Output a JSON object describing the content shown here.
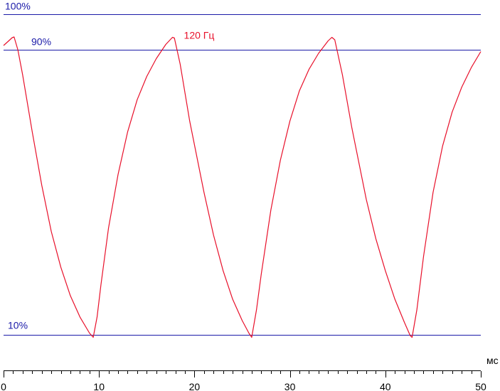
{
  "chart_data": {
    "type": "line",
    "x_unit": "мс",
    "xlim": [
      0,
      50
    ],
    "ylim": [
      0,
      110
    ],
    "x_ticks": [
      0,
      10,
      20,
      30,
      40,
      50
    ],
    "x_minor_step": 1,
    "reference_lines": [
      {
        "y": 100,
        "label": "100%"
      },
      {
        "y": 90,
        "label": "90%"
      },
      {
        "y": 10,
        "label": "10%"
      }
    ],
    "series": [
      {
        "name": "120 Гц",
        "color": "#e8102a",
        "points": [
          [
            0.0,
            91.2
          ],
          [
            0.5,
            92.4
          ],
          [
            0.9,
            93.4
          ],
          [
            1.1,
            93.6
          ],
          [
            1.5,
            90.0
          ],
          [
            2.0,
            83.0
          ],
          [
            3.0,
            67.0
          ],
          [
            4.0,
            52.0
          ],
          [
            5.0,
            39.0
          ],
          [
            6.0,
            29.0
          ],
          [
            7.0,
            21.0
          ],
          [
            8.0,
            15.0
          ],
          [
            9.0,
            10.5
          ],
          [
            9.4,
            9.3
          ],
          [
            9.8,
            15.0
          ],
          [
            10.2,
            24.0
          ],
          [
            11.0,
            40.0
          ],
          [
            12.0,
            55.0
          ],
          [
            13.0,
            67.0
          ],
          [
            14.0,
            76.0
          ],
          [
            15.0,
            82.5
          ],
          [
            16.0,
            87.5
          ],
          [
            17.0,
            91.5
          ],
          [
            17.7,
            93.5
          ],
          [
            17.9,
            93.3
          ],
          [
            18.5,
            86.0
          ],
          [
            19.5,
            70.0
          ],
          [
            21.0,
            50.0
          ],
          [
            22.0,
            38.0
          ],
          [
            23.0,
            28.0
          ],
          [
            24.0,
            20.0
          ],
          [
            25.0,
            14.0
          ],
          [
            25.7,
            10.5
          ],
          [
            26.0,
            9.3
          ],
          [
            26.5,
            17.0
          ],
          [
            27.0,
            27.0
          ],
          [
            28.0,
            45.0
          ],
          [
            29.0,
            59.0
          ],
          [
            30.0,
            70.0
          ],
          [
            31.0,
            78.5
          ],
          [
            32.0,
            84.5
          ],
          [
            33.0,
            89.0
          ],
          [
            34.0,
            92.5
          ],
          [
            34.4,
            93.5
          ],
          [
            34.7,
            92.8
          ],
          [
            35.5,
            83.0
          ],
          [
            36.5,
            68.0
          ],
          [
            38.0,
            48.0
          ],
          [
            39.0,
            37.0
          ],
          [
            40.0,
            28.0
          ],
          [
            41.0,
            20.0
          ],
          [
            42.0,
            13.5
          ],
          [
            42.6,
            9.8
          ],
          [
            42.8,
            9.3
          ],
          [
            43.3,
            17.0
          ],
          [
            44.0,
            32.0
          ],
          [
            45.0,
            50.0
          ],
          [
            46.0,
            63.0
          ],
          [
            47.0,
            72.5
          ],
          [
            48.0,
            79.5
          ],
          [
            49.0,
            85.0
          ],
          [
            50.0,
            89.5
          ]
        ]
      }
    ]
  }
}
